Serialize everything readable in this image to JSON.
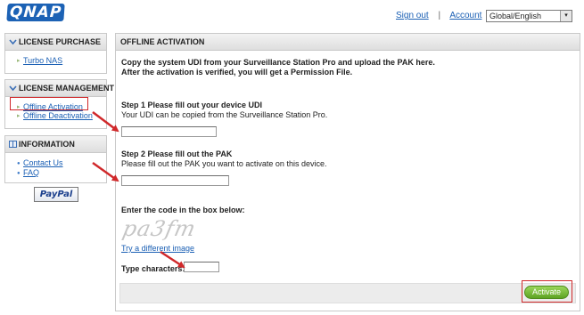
{
  "header": {
    "logo": "QNAP",
    "sign_out": "Sign out",
    "separator": "|",
    "account": "Account",
    "language": "Global/English",
    "language_arrow": "▾"
  },
  "sidebar": {
    "purchase": {
      "title": "LICENSE PURCHASE",
      "items": [
        {
          "label": "Turbo NAS"
        }
      ]
    },
    "management": {
      "title": "LICENSE MANAGEMENT",
      "items": [
        {
          "label": "Offline Activation"
        },
        {
          "label": "Offline Deactivation"
        }
      ]
    },
    "information": {
      "title": "INFORMATION",
      "items": [
        {
          "label": "Contact Us"
        },
        {
          "label": "FAQ"
        }
      ]
    },
    "paypal": "PayPal"
  },
  "main": {
    "title": "OFFLINE ACTIVATION",
    "intro_line1": "Copy the system UDI from your Surveillance Station Pro and upload the PAK here.",
    "intro_line2": "After the activation is verified, you will get a Permission File.",
    "step1_title": "Step 1 Please fill out your device UDI",
    "step1_desc": "Your UDI can be copied from the Surveillance Station Pro.",
    "step2_title": "Step 2 Please fill out the PAK",
    "step2_desc": "Please fill out the PAK you want to activate on this device.",
    "captcha_prompt": "Enter the code in the box below:",
    "captcha_text": "pa3fm",
    "try_different": "Try a different image",
    "type_characters": "Type characters:",
    "activate": "Activate"
  },
  "colors": {
    "link": "#1a5fb4",
    "annotation": "#d0282a",
    "activate": "#5ea323",
    "logo": "#1c62b5"
  }
}
